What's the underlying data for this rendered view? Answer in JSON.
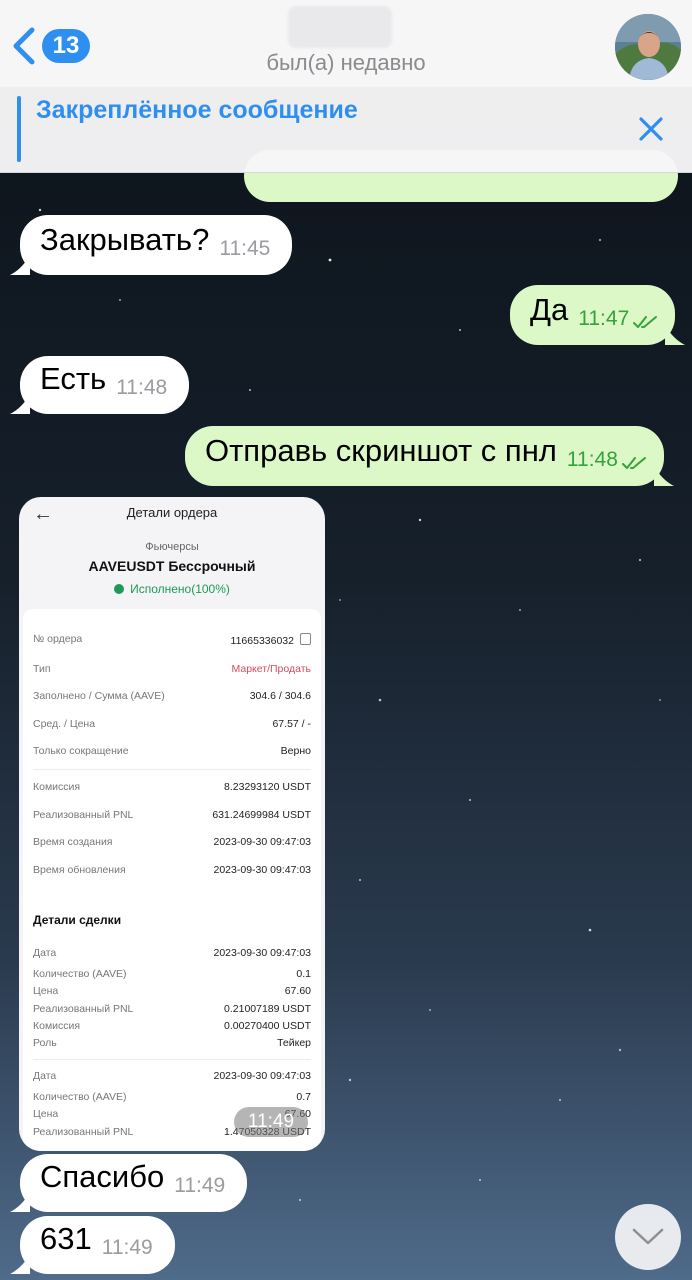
{
  "header": {
    "back_count": "13",
    "status": "был(а) недавно"
  },
  "pinned": {
    "title": "Закреплённое сообщение"
  },
  "messages": [
    {
      "text": "Закрывать?",
      "time": "11:45",
      "dir": "in"
    },
    {
      "text": "Да",
      "time": "11:47",
      "dir": "out"
    },
    {
      "text": "Есть",
      "time": "11:48",
      "dir": "in"
    },
    {
      "text": "Отправь скриншот с пнл",
      "time": "11:48",
      "dir": "out"
    },
    {
      "text": "Спасибо",
      "time": "11:49",
      "dir": "in"
    },
    {
      "text": "631",
      "time": "11:49",
      "dir": "in"
    }
  ],
  "order_card": {
    "title": "Детали ордера",
    "subtitle": "Фьючерсы",
    "pair": "AAVEUSDT Бессрочный",
    "status": "Исполнено(100%)",
    "time": "11:49",
    "rows": [
      {
        "label": "№ ордера",
        "value": "11665336032"
      },
      {
        "label": "Тип",
        "value": "Маркет/Продать"
      },
      {
        "label": "Заполнено / Сумма (AAVE)",
        "value": "304.6 / 304.6"
      },
      {
        "label": "Сред. / Цена",
        "value": "67.57 / -"
      },
      {
        "label": "Только сокращение",
        "value": "Верно"
      },
      {
        "label": "Комиссия",
        "value": "8.23293120 USDT"
      },
      {
        "label": "Реализованный PNL",
        "value": "631.24699984 USDT"
      },
      {
        "label": "Время создания",
        "value": "2023-09-30 09:47:03"
      },
      {
        "label": "Время обновления",
        "value": "2023-09-30 09:47:03"
      }
    ],
    "section_title": "Детали сделки",
    "trade1": [
      {
        "label": "Дата",
        "value": "2023-09-30 09:47:03"
      },
      {
        "label": "Количество (AAVE)",
        "value": "0.1"
      },
      {
        "label": "Цена",
        "value": "67.60"
      },
      {
        "label": "Реализованный PNL",
        "value": "0.21007189 USDT"
      },
      {
        "label": "Комиссия",
        "value": "0.00270400 USDT"
      },
      {
        "label": "Роль",
        "value": "Тейкер"
      }
    ],
    "trade2": [
      {
        "label": "Дата",
        "value": "2023-09-30 09:47:03"
      },
      {
        "label": "Количество (AAVE)",
        "value": "0.7"
      },
      {
        "label": "Цена",
        "value": "67.60"
      },
      {
        "label": "Реализованный PNL",
        "value": "1.47050328 USDT"
      }
    ]
  },
  "colors": {
    "accent": "#2f8ff0",
    "outgoing_bubble": "#dcf8c6",
    "incoming_bubble": "#ffffff",
    "read_ticks": "#36a13e",
    "sell_red": "#d44a5b",
    "filled_green": "#1d9a57"
  },
  "icons": {
    "back": "chevron-left-icon",
    "close_pinned": "close-icon",
    "read": "double-check-icon",
    "scroll_down": "chevron-down-icon"
  }
}
